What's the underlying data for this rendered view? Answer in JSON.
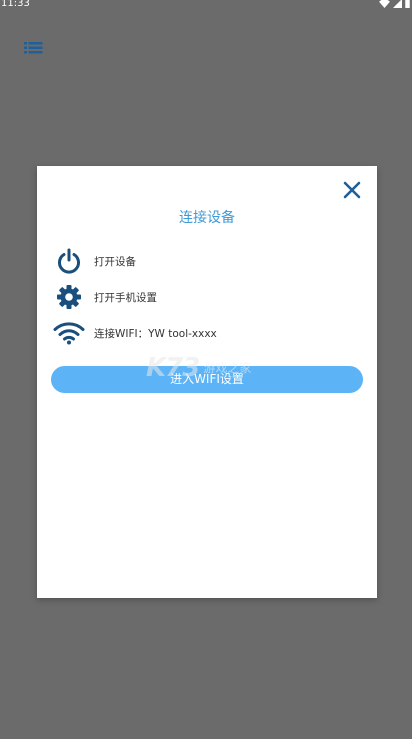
{
  "status_bar": {
    "time": "11:33"
  },
  "toolbar": {
    "menu_icon": "list-icon"
  },
  "dialog": {
    "title": "连接设备",
    "close_icon": "close-icon",
    "items": [
      {
        "icon": "power-icon",
        "label": "打开设备"
      },
      {
        "icon": "gear-icon",
        "label": "打开手机设置"
      },
      {
        "icon": "wifi-icon",
        "label": "连接WIFI：YW tool-xxxx"
      }
    ],
    "button_label": "进入WIFI设置"
  },
  "watermark": {
    "logo": "K73",
    "text": "游戏之家"
  },
  "colors": {
    "accent": "#3f9ad6",
    "icon": "#1a4e7c",
    "button": "#5cb4f7",
    "backdrop": "#6b6b6b"
  }
}
